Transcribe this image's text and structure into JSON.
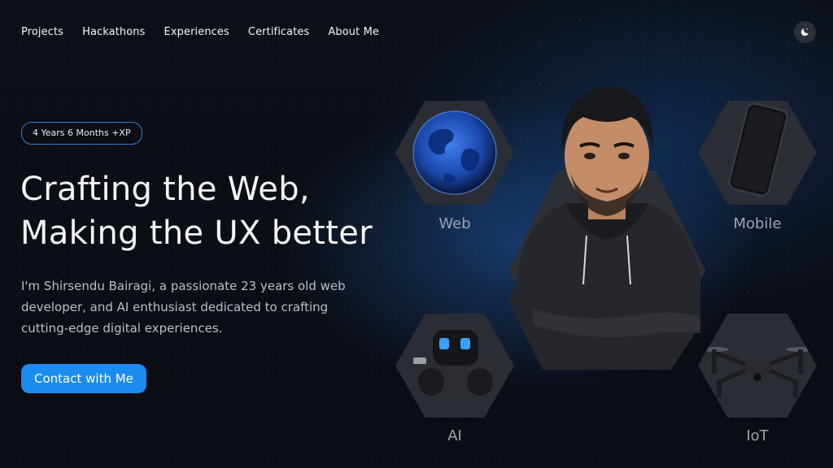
{
  "nav": {
    "items": [
      {
        "label": "Projects"
      },
      {
        "label": "Hackathons"
      },
      {
        "label": "Experiences"
      },
      {
        "label": "Certificates"
      },
      {
        "label": "About Me"
      }
    ],
    "theme_toggle_icon": "moon-icon"
  },
  "hero": {
    "badge": "4 Years 6 Months +XP",
    "title_line1": "Crafting the Web,",
    "title_line2": "Making the UX better",
    "intro": "I'm Shirsendu Bairagi, a passionate 23 years old web developer, and AI enthusiast dedicated to crafting cutting-edge digital experiences.",
    "cta": "Contact with Me"
  },
  "skills": [
    {
      "label": "Web",
      "icon": "globe-icon"
    },
    {
      "label": "Mobile",
      "icon": "smartphone-icon"
    },
    {
      "label": "AI",
      "icon": "robot-icon"
    },
    {
      "label": "IoT",
      "icon": "drone-icon"
    }
  ],
  "colors": {
    "accent": "#1a8cf0",
    "badge_border": "#2b7fd4",
    "background": "#0b0e14"
  }
}
